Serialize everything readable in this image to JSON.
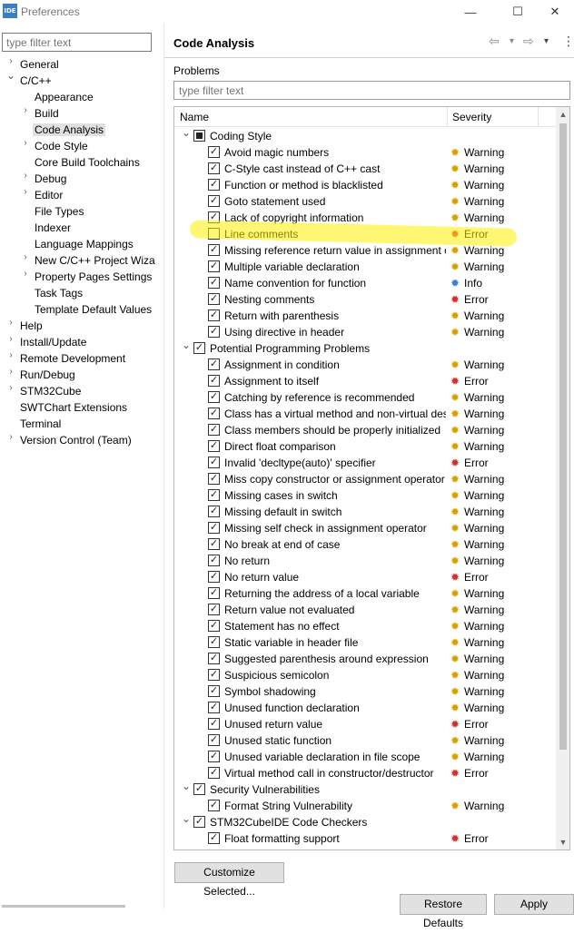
{
  "window": {
    "title": "Preferences",
    "icon_text": "IDE",
    "controls": {
      "minimize": "—",
      "maximize": "☐",
      "close": "✕"
    }
  },
  "left": {
    "filter_placeholder": "type filter text",
    "tree": [
      {
        "label": "General",
        "level": 0,
        "expander": "›"
      },
      {
        "label": "C/C++",
        "level": 0,
        "expander": "⌄"
      },
      {
        "label": "Appearance",
        "level": 1,
        "expander": ""
      },
      {
        "label": "Build",
        "level": 1,
        "expander": "›"
      },
      {
        "label": "Code Analysis",
        "level": 1,
        "expander": "",
        "selected": true
      },
      {
        "label": "Code Style",
        "level": 1,
        "expander": "›"
      },
      {
        "label": "Core Build Toolchains",
        "level": 1,
        "expander": ""
      },
      {
        "label": "Debug",
        "level": 1,
        "expander": "›"
      },
      {
        "label": "Editor",
        "level": 1,
        "expander": "›"
      },
      {
        "label": "File Types",
        "level": 1,
        "expander": ""
      },
      {
        "label": "Indexer",
        "level": 1,
        "expander": ""
      },
      {
        "label": "Language Mappings",
        "level": 1,
        "expander": ""
      },
      {
        "label": "New C/C++ Project Wiza",
        "level": 1,
        "expander": "›"
      },
      {
        "label": "Property Pages Settings",
        "level": 1,
        "expander": "›"
      },
      {
        "label": "Task Tags",
        "level": 1,
        "expander": ""
      },
      {
        "label": "Template Default Values",
        "level": 1,
        "expander": ""
      },
      {
        "label": "Help",
        "level": 0,
        "expander": "›"
      },
      {
        "label": "Install/Update",
        "level": 0,
        "expander": "›"
      },
      {
        "label": "Remote Development",
        "level": 0,
        "expander": "›"
      },
      {
        "label": "Run/Debug",
        "level": 0,
        "expander": "›"
      },
      {
        "label": "STM32Cube",
        "level": 0,
        "expander": "›"
      },
      {
        "label": "SWTChart Extensions",
        "level": 0,
        "expander": ""
      },
      {
        "label": "Terminal",
        "level": 0,
        "expander": ""
      },
      {
        "label": "Version Control (Team)",
        "level": 0,
        "expander": "›"
      }
    ]
  },
  "page": {
    "title": "Code Analysis",
    "problems_label": "Problems",
    "problems_filter_placeholder": "type filter text",
    "nav": {
      "back": "⇦",
      "back_menu": "▾",
      "forward": "⇨",
      "forward_menu": "▾",
      "more": "⋮"
    },
    "columns": {
      "name": "Name",
      "severity": "Severity"
    },
    "rows": [
      {
        "type": "group",
        "label": "Coding Style",
        "check": "partial"
      },
      {
        "type": "item",
        "label": "Avoid magic numbers",
        "check": "checked",
        "severity": "Warning"
      },
      {
        "type": "item",
        "label": "C-Style cast instead of C++ cast",
        "check": "checked",
        "severity": "Warning"
      },
      {
        "type": "item",
        "label": "Function or method is blacklisted",
        "check": "checked",
        "severity": "Warning"
      },
      {
        "type": "item",
        "label": "Goto statement used",
        "check": "checked",
        "severity": "Warning"
      },
      {
        "type": "item",
        "label": "Lack of copyright information",
        "check": "checked",
        "severity": "Warning"
      },
      {
        "type": "item",
        "label": "Line comments",
        "check": "unchecked",
        "severity": "Error"
      },
      {
        "type": "item",
        "label": "Missing reference return value in assignment o",
        "check": "checked",
        "severity": "Warning"
      },
      {
        "type": "item",
        "label": "Multiple variable declaration",
        "check": "checked",
        "severity": "Warning"
      },
      {
        "type": "item",
        "label": "Name convention for function",
        "check": "checked",
        "severity": "Info"
      },
      {
        "type": "item",
        "label": "Nesting comments",
        "check": "checked",
        "severity": "Error"
      },
      {
        "type": "item",
        "label": "Return with parenthesis",
        "check": "checked",
        "severity": "Warning"
      },
      {
        "type": "item",
        "label": "Using directive in header",
        "check": "checked",
        "severity": "Warning"
      },
      {
        "type": "group",
        "label": "Potential Programming Problems",
        "check": "checked"
      },
      {
        "type": "item",
        "label": "Assignment in condition",
        "check": "checked",
        "severity": "Warning"
      },
      {
        "type": "item",
        "label": "Assignment to itself",
        "check": "checked",
        "severity": "Error"
      },
      {
        "type": "item",
        "label": "Catching by reference is recommended",
        "check": "checked",
        "severity": "Warning"
      },
      {
        "type": "item",
        "label": "Class has a virtual method and non-virtual des",
        "check": "checked",
        "severity": "Warning"
      },
      {
        "type": "item",
        "label": "Class members should be properly initialized",
        "check": "checked",
        "severity": "Warning"
      },
      {
        "type": "item",
        "label": "Direct float comparison",
        "check": "checked",
        "severity": "Warning"
      },
      {
        "type": "item",
        "label": "Invalid 'decltype(auto)' specifier",
        "check": "checked",
        "severity": "Error"
      },
      {
        "type": "item",
        "label": "Miss copy constructor or assignment operator",
        "check": "checked",
        "severity": "Warning"
      },
      {
        "type": "item",
        "label": "Missing cases in switch",
        "check": "checked",
        "severity": "Warning"
      },
      {
        "type": "item",
        "label": "Missing default in switch",
        "check": "checked",
        "severity": "Warning"
      },
      {
        "type": "item",
        "label": "Missing self check in assignment operator",
        "check": "checked",
        "severity": "Warning"
      },
      {
        "type": "item",
        "label": "No break at end of case",
        "check": "checked",
        "severity": "Warning"
      },
      {
        "type": "item",
        "label": "No return",
        "check": "checked",
        "severity": "Warning"
      },
      {
        "type": "item",
        "label": "No return value",
        "check": "checked",
        "severity": "Error"
      },
      {
        "type": "item",
        "label": "Returning the address of a local variable",
        "check": "checked",
        "severity": "Warning"
      },
      {
        "type": "item",
        "label": "Return value not evaluated",
        "check": "checked",
        "severity": "Warning"
      },
      {
        "type": "item",
        "label": "Statement has no effect",
        "check": "checked",
        "severity": "Warning"
      },
      {
        "type": "item",
        "label": "Static variable in header file",
        "check": "checked",
        "severity": "Warning"
      },
      {
        "type": "item",
        "label": "Suggested parenthesis around expression",
        "check": "checked",
        "severity": "Warning"
      },
      {
        "type": "item",
        "label": "Suspicious semicolon",
        "check": "checked",
        "severity": "Warning"
      },
      {
        "type": "item",
        "label": "Symbol shadowing",
        "check": "checked",
        "severity": "Warning"
      },
      {
        "type": "item",
        "label": "Unused function declaration",
        "check": "checked",
        "severity": "Warning"
      },
      {
        "type": "item",
        "label": "Unused return value",
        "check": "checked",
        "severity": "Error"
      },
      {
        "type": "item",
        "label": "Unused static function",
        "check": "checked",
        "severity": "Warning"
      },
      {
        "type": "item",
        "label": "Unused variable declaration in file scope",
        "check": "checked",
        "severity": "Warning"
      },
      {
        "type": "item",
        "label": "Virtual method call in constructor/destructor",
        "check": "checked",
        "severity": "Error"
      },
      {
        "type": "group",
        "label": "Security Vulnerabilities",
        "check": "checked"
      },
      {
        "type": "item",
        "label": "Format String Vulnerability",
        "check": "checked",
        "severity": "Warning"
      },
      {
        "type": "group",
        "label": "STM32CubeIDE Code Checkers",
        "check": "checked"
      },
      {
        "type": "item",
        "label": "Float formatting support",
        "check": "checked",
        "severity": "Error"
      }
    ]
  },
  "buttons": {
    "customize": "Customize Selected...",
    "restore": "Restore Defaults",
    "apply": "Apply"
  },
  "colors": {
    "warning": "#d8a000",
    "error": "#d03030",
    "info": "#3a7fd0",
    "highlight": "#ffee00"
  }
}
